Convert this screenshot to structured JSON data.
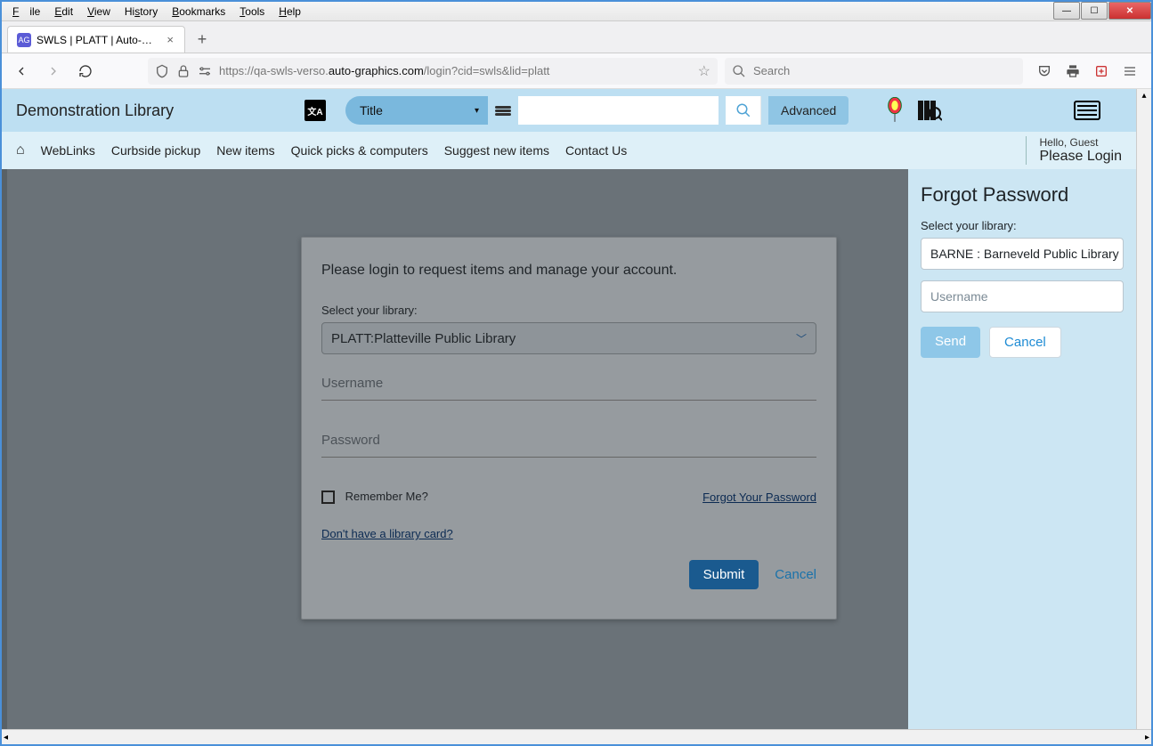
{
  "browser": {
    "menus": {
      "file": "File",
      "edit": "Edit",
      "view": "View",
      "history": "History",
      "bookmarks": "Bookmarks",
      "tools": "Tools",
      "help": "Help"
    },
    "tab_title": "SWLS | PLATT | Auto-Graphics In",
    "url_prefix": "https://qa-swls-verso.",
    "url_domain": "auto-graphics.com",
    "url_path": "/login?cid=swls&lid=platt",
    "search_placeholder": "Search"
  },
  "app": {
    "library_name": "Demonstration Library",
    "search_type": "Title",
    "advanced": "Advanced",
    "nav": {
      "weblinks": "WebLinks",
      "curbside": "Curbside pickup",
      "new_items": "New items",
      "quick": "Quick picks & computers",
      "suggest": "Suggest new items",
      "contact": "Contact Us"
    },
    "greet": "Hello, Guest",
    "please_login": "Please Login"
  },
  "login": {
    "heading": "Please login to request items and manage your account.",
    "select_label": "Select your library:",
    "library_value": "PLATT:Platteville Public Library",
    "username_ph": "Username",
    "password_ph": "Password",
    "remember": "Remember Me?",
    "forgot": "Forgot Your Password",
    "no_card": "Don't have a library card?",
    "submit": "Submit",
    "cancel": "Cancel"
  },
  "forgot_panel": {
    "title": "Forgot Password",
    "select_label": "Select your library:",
    "library_value": "BARNE : Barneveld Public Library",
    "username_ph": "Username",
    "send": "Send",
    "cancel": "Cancel"
  }
}
